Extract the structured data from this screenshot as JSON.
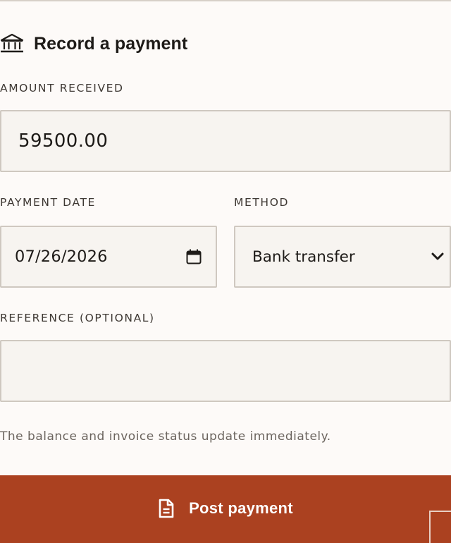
{
  "section": {
    "title": "Record a payment",
    "icon": "bank-icon"
  },
  "amount": {
    "label": "AMOUNT RECEIVED",
    "value": "59500.00"
  },
  "payment_date": {
    "label": "PAYMENT DATE",
    "value": "07/26/2026",
    "icon": "calendar-icon"
  },
  "method": {
    "label": "METHOD",
    "selected": "Bank transfer",
    "icon": "chevron-down-icon"
  },
  "reference": {
    "label": "REFERENCE (OPTIONAL)",
    "value": ""
  },
  "help_text": "The balance and invoice status update immediately.",
  "submit": {
    "label": "Post payment",
    "icon": "document-icon"
  },
  "colors": {
    "accent": "#ab4120",
    "field_background": "#f7f4f0",
    "field_border": "#cfc8c0",
    "page_background": "#fdfaf8"
  }
}
